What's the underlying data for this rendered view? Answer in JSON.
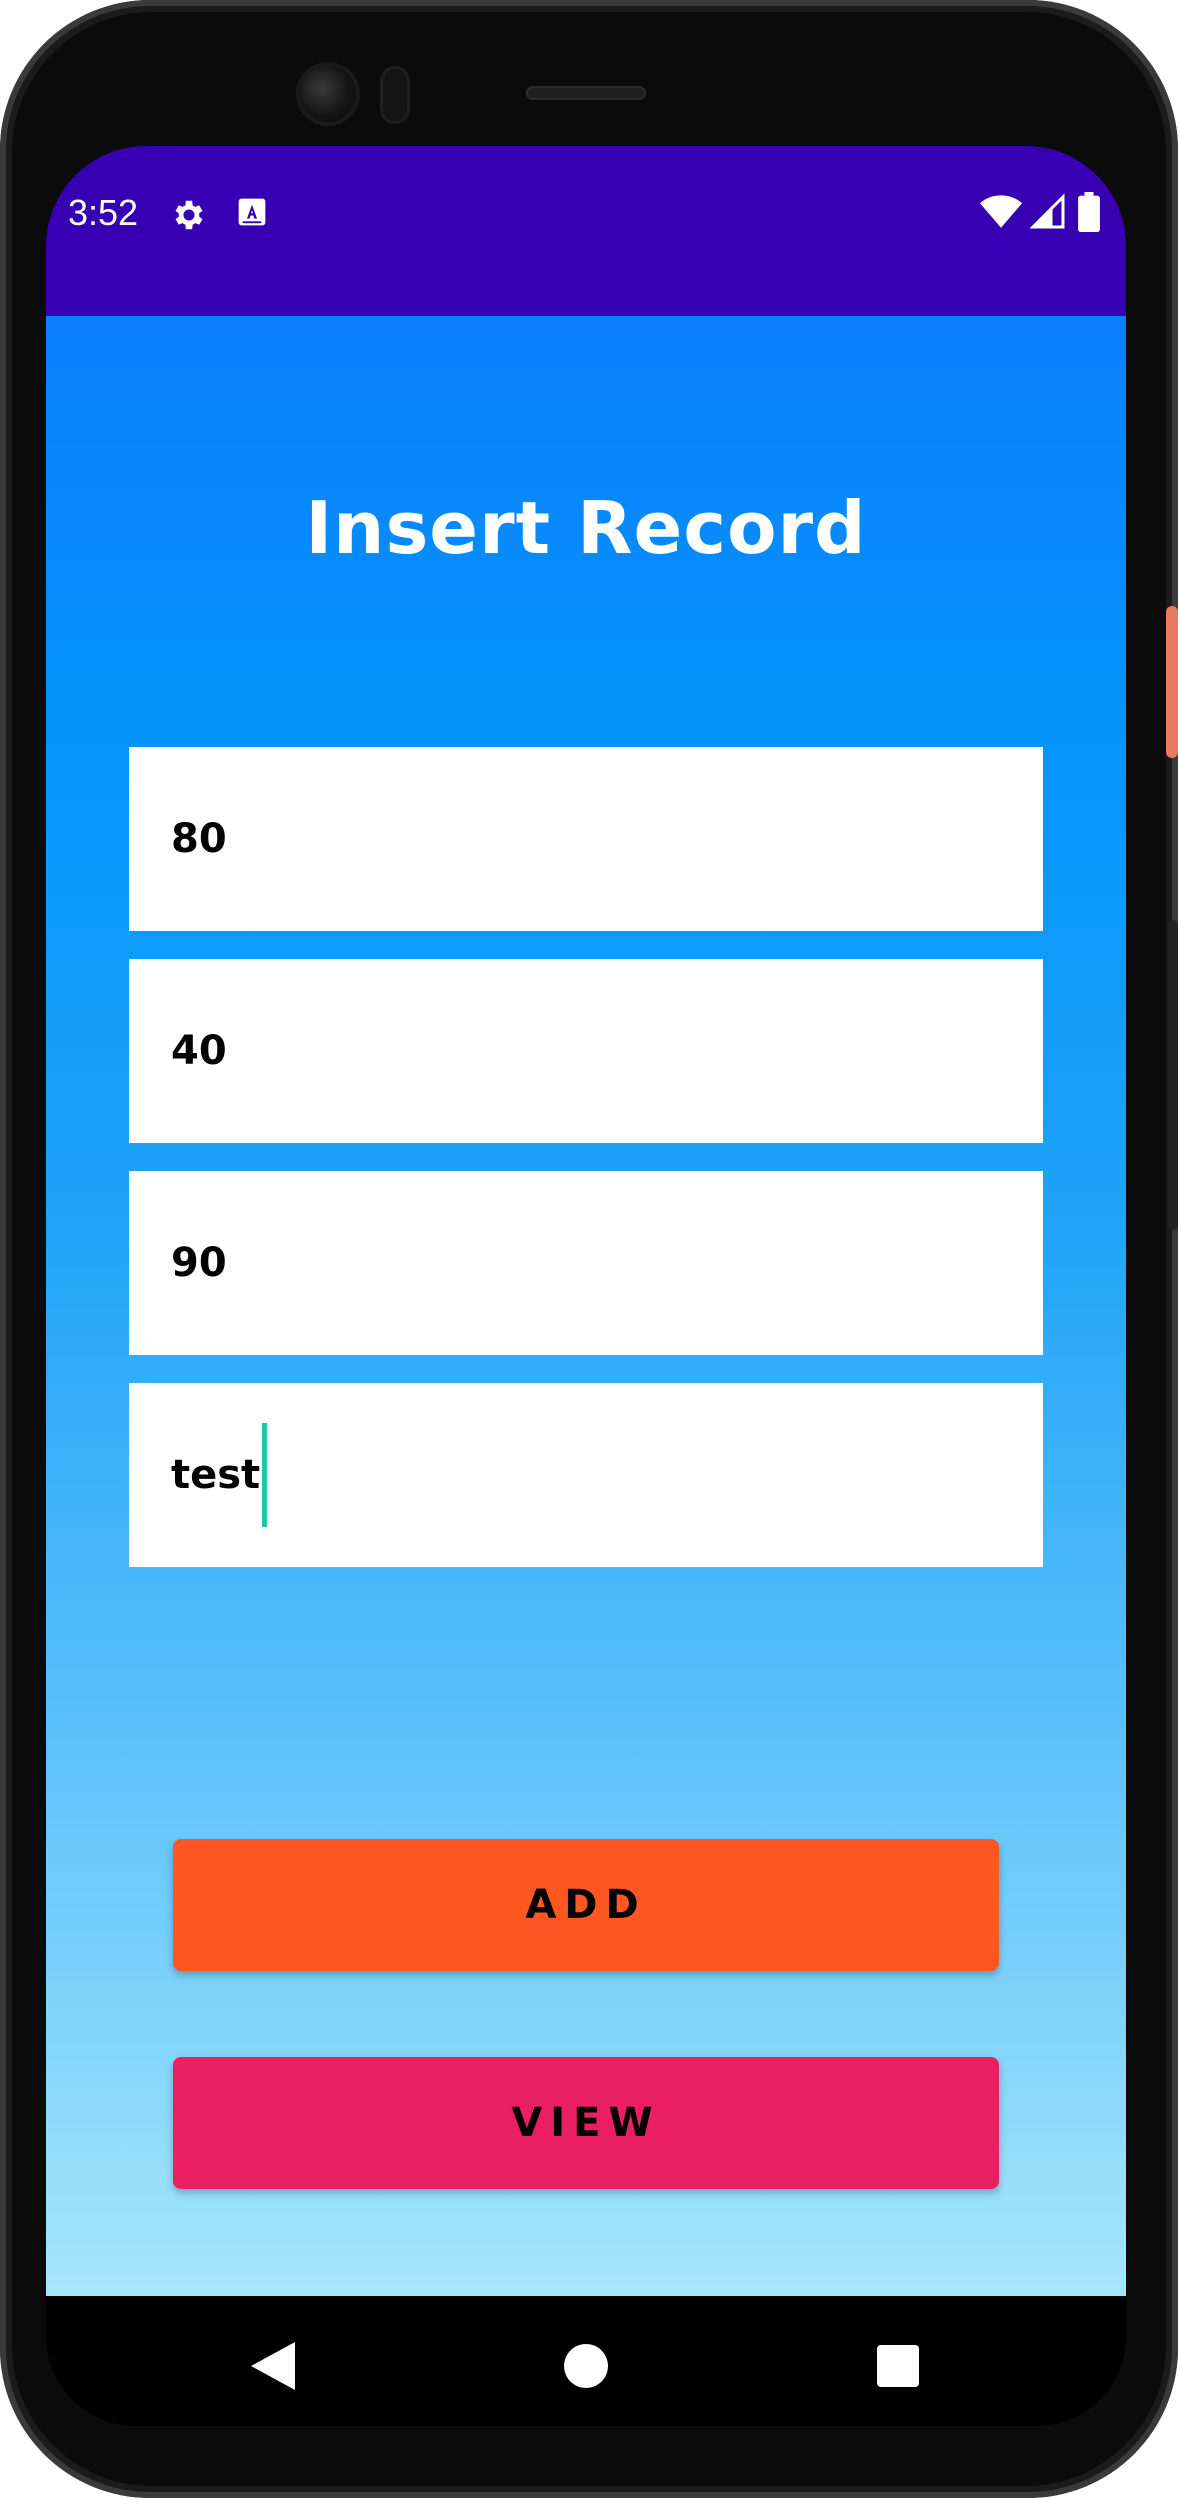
{
  "status_bar": {
    "time": "3:52",
    "icons": [
      "gear-icon",
      "text-a-icon",
      "wifi-icon",
      "signal-icon",
      "battery-icon"
    ],
    "background": "#3700b3"
  },
  "screen": {
    "title": "Insert Record"
  },
  "fields": [
    {
      "value": "80"
    },
    {
      "value": "40"
    },
    {
      "value": "90"
    },
    {
      "value": "test",
      "focused": true
    }
  ],
  "buttons": {
    "add_label": "ADD",
    "add_color": "#ff5722",
    "view_label": "VIEW",
    "view_color": "#e91e63"
  },
  "nav_bar": {
    "icons": [
      "back-icon",
      "home-icon",
      "recents-icon"
    ]
  },
  "colors": {
    "gradient_top": "#0a7ffc",
    "gradient_bottom": "#a6e6fb",
    "caret": "#1ec8a5"
  }
}
